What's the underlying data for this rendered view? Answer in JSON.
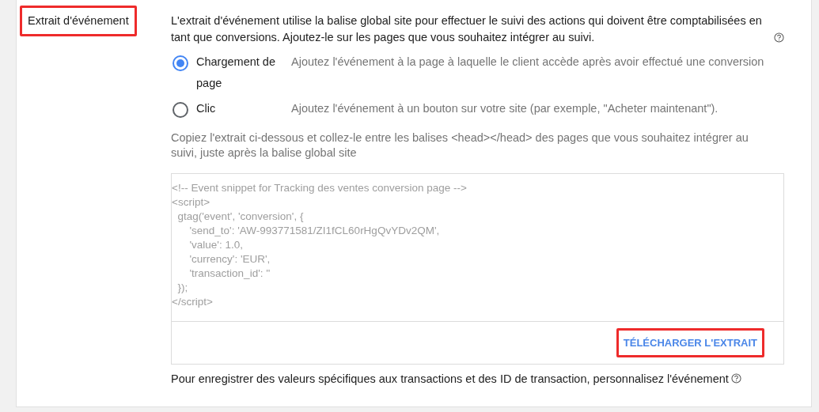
{
  "section_label": {
    "text": "Extrait d'événement",
    "highlighted": true
  },
  "description": "L'extrait d'événement utilise la balise global site pour effectuer le suivi des actions qui doivent être comptabilisées en tant que conversions. Ajoutez-le sur les pages que vous souhaitez intégrer au suivi.",
  "options": [
    {
      "label": "Chargement de page",
      "hint": "Ajoutez l'événement à la page à laquelle le client accède après avoir effectué une conversion",
      "selected": true
    },
    {
      "label": "Clic",
      "hint": "Ajoutez l'événement à un bouton sur votre site (par exemple, \"Acheter maintenant\").",
      "selected": false
    }
  ],
  "instructions": "Copiez l'extrait ci-dessous et collez-le entre les balises <head></head> des pages que vous souhaitez intégrer au suivi, juste après la balise global site",
  "code_lines": [
    "<!-- Event snippet for Tracking des ventes conversion page -->",
    "<script>",
    "  gtag('event', 'conversion', {",
    "      'send_to': 'AW-993771581/ZI1fCL60rHgQvYDv2QM',",
    "      'value': 1.0,",
    "      'currency': 'EUR',",
    "      'transaction_id': ''",
    "  });",
    "</script>"
  ],
  "download_button": {
    "label": "TÉLÉCHARGER L'EXTRAIT",
    "highlighted": true
  },
  "footer_note": "Pour enregistrer des valeurs spécifiques aux transactions et des ID de transaction, personnalisez l'événement"
}
